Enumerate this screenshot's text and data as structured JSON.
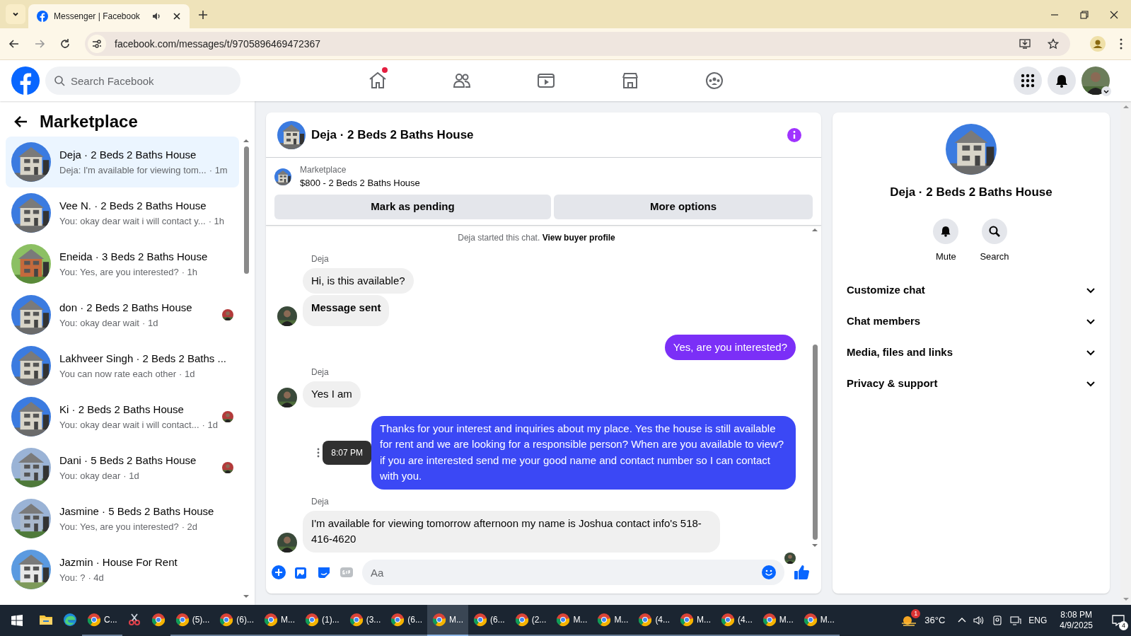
{
  "browser": {
    "tabs": [
      {
        "title": "Messenger | Facebook",
        "selected": true,
        "audio": true
      }
    ],
    "url": "facebook.com/messages/t/9705896469472367"
  },
  "header": {
    "search_placeholder": "Search Facebook",
    "nav": [
      {
        "kind": "home",
        "dot": true
      },
      {
        "kind": "friends",
        "dot": false
      },
      {
        "kind": "video",
        "dot": false
      },
      {
        "kind": "marketplace",
        "dot": false
      },
      {
        "kind": "groups",
        "dot": false
      }
    ]
  },
  "sidebar": {
    "title": "Marketplace",
    "conversations": [
      {
        "title": "Deja · 2 Beds 2 Baths House",
        "preview": "Deja: I'm available for viewing tom...",
        "time": "· 1m",
        "selected": true,
        "read_receipt": false
      },
      {
        "title": "Vee N. · 2 Beds 2 Baths House",
        "preview": "You: okay dear wait i will contact y...",
        "time": "· 1h",
        "selected": false,
        "read_receipt": false
      },
      {
        "title": "Eneida · 3 Beds 2 Baths House",
        "preview": "You: Yes, are you interested?",
        "time": "· 1h",
        "selected": false,
        "read_receipt": false
      },
      {
        "title": "don · 2 Beds 2 Baths House",
        "preview": "You: okay dear wait",
        "time": "· 1d",
        "selected": false,
        "read_receipt": true
      },
      {
        "title": "Lakhveer Singh · 2 Beds 2 Baths ...",
        "preview": "You can now rate each other",
        "time": "· 1d",
        "selected": false,
        "read_receipt": false
      },
      {
        "title": "Ki · 2 Beds 2 Baths House",
        "preview": "You: okay dear wait i will contact...",
        "time": "· 1d",
        "selected": false,
        "read_receipt": true
      },
      {
        "title": "Dani · 5 Beds 2 Baths House",
        "preview": "You: okay dear",
        "time": "· 1d",
        "selected": false,
        "read_receipt": true
      },
      {
        "title": "Jasmine · 5 Beds 2 Baths House",
        "preview": "You: Yes, are you interested?",
        "time": "· 2d",
        "selected": false,
        "read_receipt": false
      },
      {
        "title": "Jazmin · House For Rent",
        "preview": "You: ?",
        "time": "· 4d",
        "selected": false,
        "read_receipt": false
      }
    ]
  },
  "chat": {
    "title": "Deja · 2 Beds 2 Baths House",
    "listing": {
      "label": "Marketplace",
      "title": "$800 - 2 Beds 2 Baths House"
    },
    "buttons": [
      "Mark as pending",
      "More options"
    ],
    "intro": {
      "text": "Deja started this chat.",
      "link": "View buyer profile"
    },
    "groups": [
      {
        "kind": "incoming",
        "sender": "Deja",
        "bubbles": [
          {
            "text": "Hi, is this available?",
            "bold": false
          },
          {
            "text": "Message sent",
            "bold": true
          }
        ]
      },
      {
        "kind": "outgoing",
        "bubbles": [
          {
            "text": "Yes, are you interested?",
            "color": "#7b2ff7"
          }
        ]
      },
      {
        "kind": "incoming",
        "sender": "Deja",
        "bubbles": [
          {
            "text": "Yes I am",
            "bold": false
          }
        ]
      },
      {
        "kind": "outgoing",
        "bubbles": [
          {
            "text": "Thanks for your interest and inquiries about my place. Yes the house is still available for rent and we are looking for a responsible person? When are you available to view? if you are interested send me your good name and contact number so I can contact with you.",
            "color": "#3b48f5",
            "tooltip": "8:07 PM"
          }
        ]
      },
      {
        "kind": "incoming",
        "sender": "Deja",
        "bubbles": [
          {
            "text": "I'm available for viewing tomorrow afternoon my name is Joshua contact info's 518-416-4620",
            "bold": false
          }
        ]
      }
    ],
    "composer_placeholder": "Aa"
  },
  "details": {
    "title": "Deja · 2 Beds 2 Baths House",
    "actions": [
      {
        "kind": "mute",
        "label": "Mute"
      },
      {
        "kind": "search",
        "label": "Search"
      }
    ],
    "sections": [
      {
        "label": "Customize chat",
        "expanded": false
      },
      {
        "label": "Chat members",
        "expanded": false
      },
      {
        "label": "Media, files and links",
        "expanded": false
      },
      {
        "label": "Privacy & support",
        "expanded": false
      }
    ]
  },
  "taskbar": {
    "items": [
      {
        "kind": "explorer",
        "selected": false
      },
      {
        "kind": "edge",
        "selected": false
      },
      {
        "kind": "chrome",
        "label": "C...",
        "selected": false
      },
      {
        "kind": "snip",
        "selected": false
      },
      {
        "kind": "chrome",
        "selected": false
      },
      {
        "kind": "chrome",
        "label": "(5)...",
        "selected": false
      },
      {
        "kind": "chrome",
        "label": "(6)...",
        "selected": false
      },
      {
        "kind": "chrome",
        "label": "M...",
        "selected": false
      },
      {
        "kind": "chrome",
        "label": "(1)...",
        "selected": false
      },
      {
        "kind": "chrome",
        "label": "(3...",
        "selected": false
      },
      {
        "kind": "chrome",
        "label": "(6...",
        "selected": false
      },
      {
        "kind": "chrome",
        "label": "M...",
        "selected": true
      },
      {
        "kind": "chrome",
        "label": "(6...",
        "selected": false
      },
      {
        "kind": "chrome",
        "label": "(2...",
        "selected": false
      },
      {
        "kind": "chrome",
        "label": "M...",
        "selected": false
      },
      {
        "kind": "chrome",
        "label": "M...",
        "selected": false
      },
      {
        "kind": "chrome",
        "label": "(4...",
        "selected": false
      },
      {
        "kind": "chrome",
        "label": "M...",
        "selected": false
      },
      {
        "kind": "chrome",
        "label": "(4...",
        "selected": false
      },
      {
        "kind": "chrome",
        "label": "M...",
        "selected": false
      },
      {
        "kind": "chrome",
        "label": "M...",
        "selected": false
      }
    ],
    "weather_badge": "1",
    "temperature": "36°C",
    "language": "ENG",
    "time": "8:08 PM",
    "date": "4/9/2025",
    "notifications": "4"
  }
}
